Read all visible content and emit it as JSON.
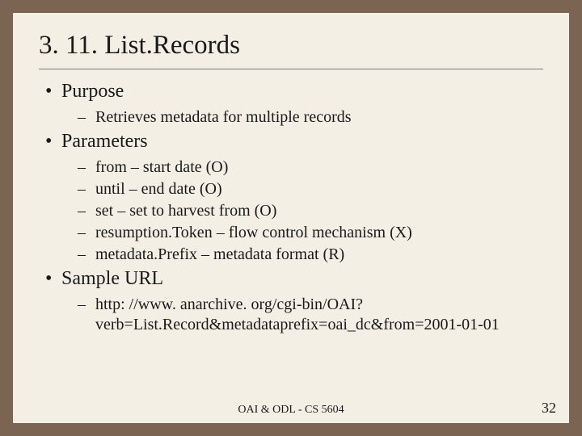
{
  "title": "3. 11. List.Records",
  "bullets": {
    "purpose": {
      "label": "Purpose",
      "items": [
        "Retrieves metadata for multiple records"
      ]
    },
    "parameters": {
      "label": "Parameters",
      "items": [
        " from – start date (O)",
        " until – end date (O)",
        " set – set to harvest from (O)",
        " resumption.Token – flow control mechanism (X)",
        " metadata.Prefix – metadata format (R)"
      ]
    },
    "sample_url": {
      "label": "Sample URL",
      "items": [
        "http: //www. anarchive. org/cgi-bin/OAI? verb=List.Record&metadataprefix=oai_dc&from=2001-01-01"
      ]
    }
  },
  "footer": {
    "center": "OAI & ODL - CS 5604",
    "page": "32"
  }
}
